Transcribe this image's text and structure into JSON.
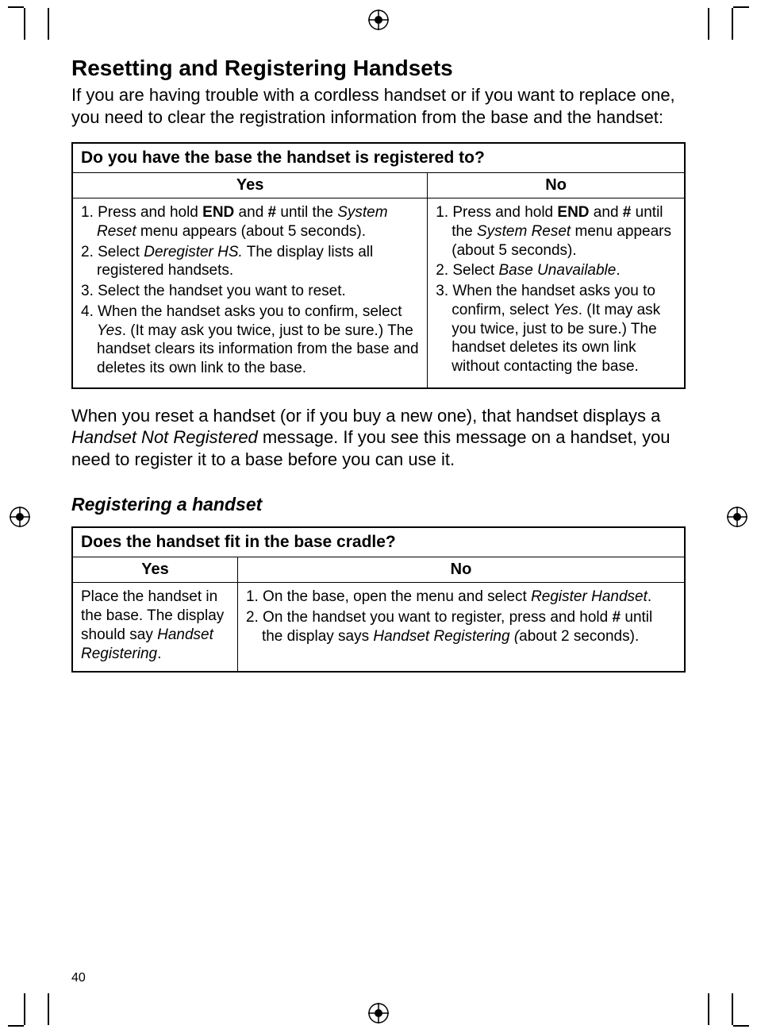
{
  "section_title": "Resetting and Registering Handsets",
  "intro": "If you are having trouble with a cordless handset or if you want to replace one, you need to clear the registration information from the base and the handset:",
  "table1": {
    "question": "Do you have the base the handset is registered to?",
    "yes_header": "Yes",
    "no_header": "No",
    "yes_steps_html": "1. Press and hold <b>END</b> and <b>#</b> until the <i>System Reset</i> menu appears (about 5 seconds).|2. Select <i>Deregister HS.</i> The display lists all registered handsets.|3. Select the handset you want to reset.|4. When the handset asks you to confirm, select <i>Yes</i>. (It may ask you twice, just to be sure.) The handset clears its information from the base and deletes its own link to the base.",
    "no_steps_html": "1. Press and hold <b>END</b> and <b>#</b> until the <i>System Reset</i> menu appears (about 5 seconds).|2. Select <i>Base Unavailable</i>.|3. When the handset asks you to confirm, select <i>Yes</i>. (It may ask you twice, just to be sure.) The handset deletes its own link without contacting the base."
  },
  "mid_para": "When you reset a handset (or if you buy a new one), that handset displays a <i>Handset Not Registered</i> message. If you see this message on a handset, you need to register it to a base before you can use it.",
  "subhead": "Registering a handset",
  "table2": {
    "question": "Does the handset fit in the base cradle?",
    "yes_header": "Yes",
    "no_header": "No",
    "yes_html": "Place the handset in the base. The display should say <i>Handset Registering</i>.",
    "no_steps_html": "1. On the base, open the menu and select <i>Register Handset</i>.|2. On the handset you want to register, press and hold <b>#</b> until the display says <i>Handset Registering (</i>about 2 seconds)."
  },
  "page_number": "40"
}
